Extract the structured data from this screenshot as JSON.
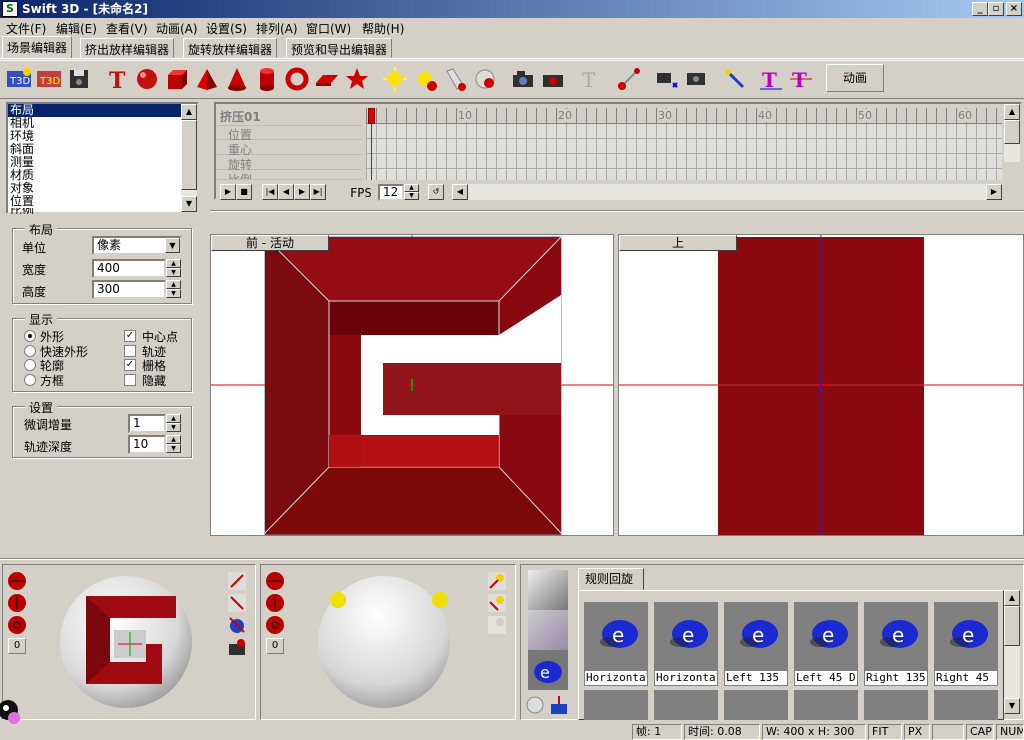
{
  "window": {
    "title": "Swift 3D - [未命名2]",
    "app_icon": "S"
  },
  "menu": [
    "文件(F)",
    "编辑(E)",
    "查看(V)",
    "动画(A)",
    "设置(S)",
    "排列(A)",
    "窗口(W)",
    "帮助(H)"
  ],
  "tabs": [
    "场景编辑器",
    "挤出放样编辑器",
    "旋转放样编辑器",
    "预览和导出编辑器"
  ],
  "toolbar": {
    "animate_label": "动画"
  },
  "property_list": [
    "布局",
    "相机",
    "环境",
    "斜面",
    "测量",
    "材质",
    "对象",
    "位置",
    "比例"
  ],
  "layout_group": {
    "title": "布局",
    "unit_label": "单位",
    "unit_value": "像素",
    "width_label": "宽度",
    "width_value": "400",
    "height_label": "高度",
    "height_value": "300"
  },
  "display_group": {
    "title": "显示",
    "radios": [
      "外形",
      "快速外形",
      "轮廓",
      "方框"
    ],
    "checks": [
      {
        "label": "中心点",
        "checked": true
      },
      {
        "label": "轨迹",
        "checked": false
      },
      {
        "label": "栅格",
        "checked": true
      },
      {
        "label": "隐藏",
        "checked": false
      }
    ]
  },
  "settings_group": {
    "title": "设置",
    "nudge_label": "微调增量",
    "nudge_value": "1",
    "trail_label": "轨迹深度",
    "trail_value": "10"
  },
  "timeline": {
    "track_name": "挤压01",
    "rows": [
      "位置",
      "重心",
      "旋转",
      "比例"
    ],
    "ticks": [
      "10",
      "20",
      "30",
      "40",
      "50",
      "60"
    ],
    "fps_label": "FPS",
    "fps_value": "12"
  },
  "viewports": {
    "front_label": "前 - 活动",
    "top_label": "上"
  },
  "lighting": {
    "zero_label_1": "0",
    "zero_label_2": "0"
  },
  "gallery": {
    "tab_label": "规则回旋",
    "items": [
      "Horizontal",
      "Horizontal",
      "Left 135",
      "Left 45 D",
      "Right 135",
      "Right 45"
    ]
  },
  "status": {
    "frame": "帧: 1",
    "time": "时间: 0.08",
    "size": "W: 400 x H: 300",
    "fit": "FIT",
    "px": "PX",
    "cap": "CAP",
    "num": "NUM"
  },
  "colors": {
    "accent": "#0a246a",
    "model_red": "#8b0a10",
    "face_color": "#d4d0c8"
  }
}
